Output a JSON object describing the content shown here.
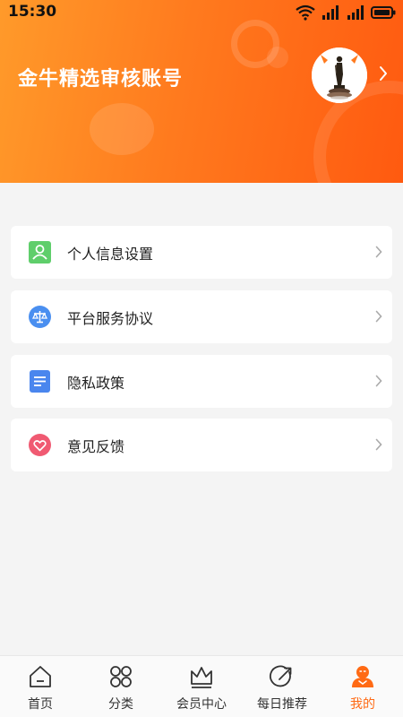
{
  "status_bar": {
    "time": "15:30"
  },
  "header": {
    "account_name": "金牛精选审核账号"
  },
  "menu": [
    {
      "label": "个人信息设置",
      "icon": "user-settings-icon"
    },
    {
      "label": "平台服务协议",
      "icon": "scales-icon"
    },
    {
      "label": "隐私政策",
      "icon": "document-icon"
    },
    {
      "label": "意见反馈",
      "icon": "heart-icon"
    }
  ],
  "tabs": [
    {
      "label": "首页",
      "icon": "home-icon",
      "active": false
    },
    {
      "label": "分类",
      "icon": "category-icon",
      "active": false
    },
    {
      "label": "会员中心",
      "icon": "crown-icon",
      "active": false
    },
    {
      "label": "每日推荐",
      "icon": "arrow-circle-icon",
      "active": false
    },
    {
      "label": "我的",
      "icon": "profile-icon",
      "active": true
    }
  ],
  "colors": {
    "accent": "#ff6a14",
    "header_start": "#ff9a2a",
    "header_end": "#ff5a10"
  }
}
